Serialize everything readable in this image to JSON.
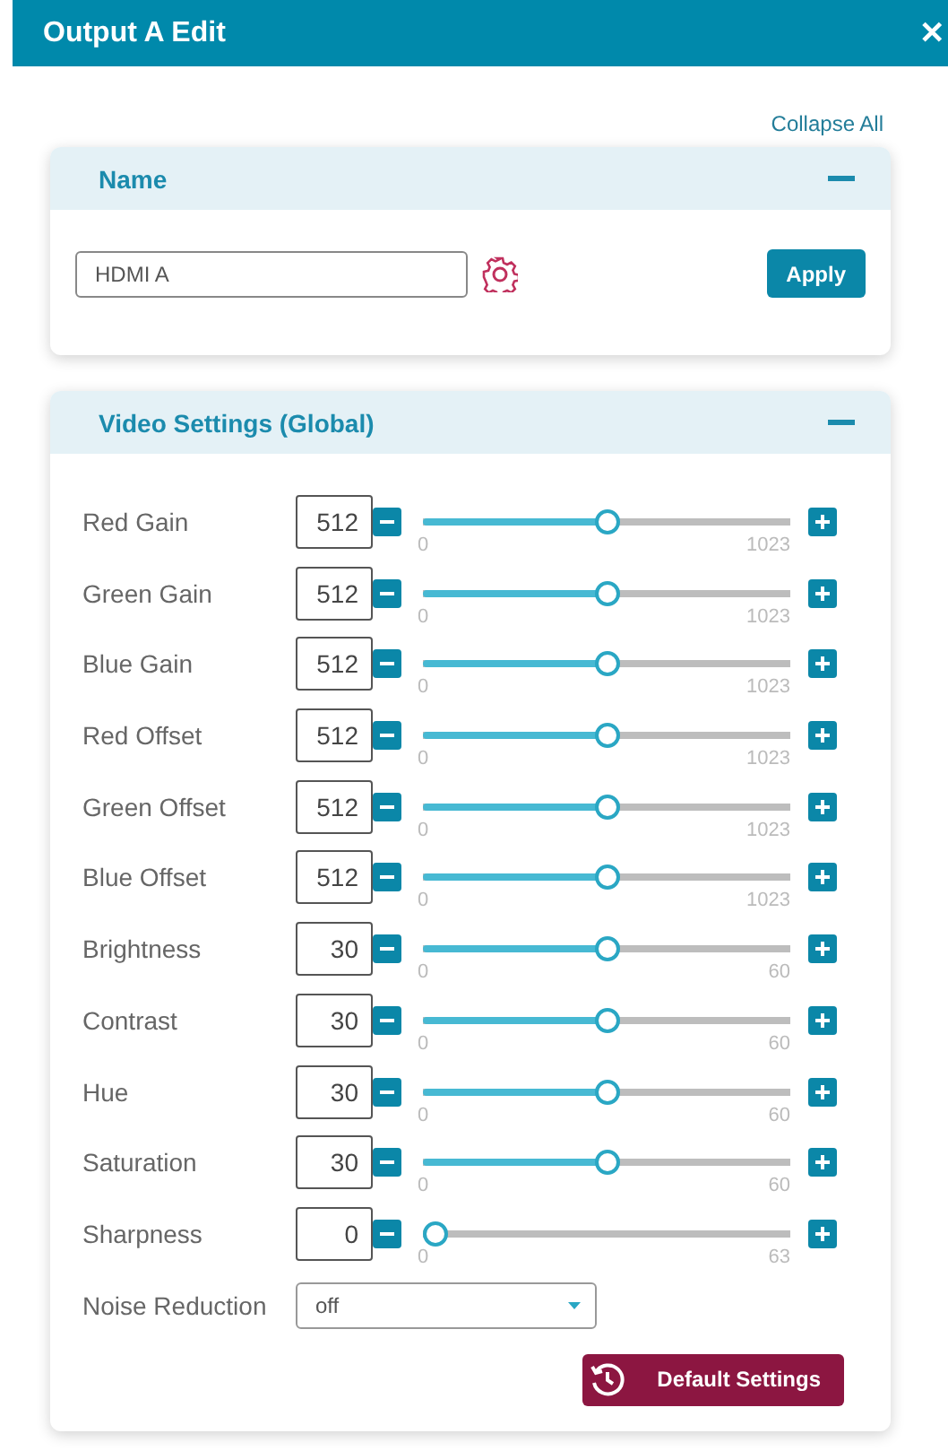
{
  "window": {
    "title": "Output A Edit",
    "close": "✕"
  },
  "collapse_all": "Collapse All",
  "name_section": {
    "title": "Name",
    "expanded": true,
    "value": "HDMI A",
    "apply": "Apply"
  },
  "video_section": {
    "title": "Video Settings (Global)",
    "expanded": true,
    "sliders": [
      {
        "label": "Red Gain",
        "value": "512",
        "min": "0",
        "max": "1023",
        "level": 0.5
      },
      {
        "label": "Green Gain",
        "value": "512",
        "min": "0",
        "max": "1023",
        "level": 0.5
      },
      {
        "label": "Blue Gain",
        "value": "512",
        "min": "0",
        "max": "1023",
        "level": 0.5
      },
      {
        "label": "Red Offset",
        "value": "512",
        "min": "0",
        "max": "1023",
        "level": 0.5
      },
      {
        "label": "Green Offset",
        "value": "512",
        "min": "0",
        "max": "1023",
        "level": 0.5
      },
      {
        "label": "Blue Offset",
        "value": "512",
        "min": "0",
        "max": "1023",
        "level": 0.5
      },
      {
        "label": "Brightness",
        "value": "30",
        "min": "0",
        "max": "60",
        "level": 0.5
      },
      {
        "label": "Contrast",
        "value": "30",
        "min": "0",
        "max": "60",
        "level": 0.5
      },
      {
        "label": "Hue",
        "value": "30",
        "min": "0",
        "max": "60",
        "level": 0.5
      },
      {
        "label": "Saturation",
        "value": "30",
        "min": "0",
        "max": "60",
        "level": 0.5
      },
      {
        "label": "Sharpness",
        "value": "0",
        "min": "0",
        "max": "63",
        "level": 0
      }
    ],
    "noise_reduction": {
      "label": "Noise Reduction",
      "value": "off"
    },
    "default_button": "Default Settings"
  }
}
